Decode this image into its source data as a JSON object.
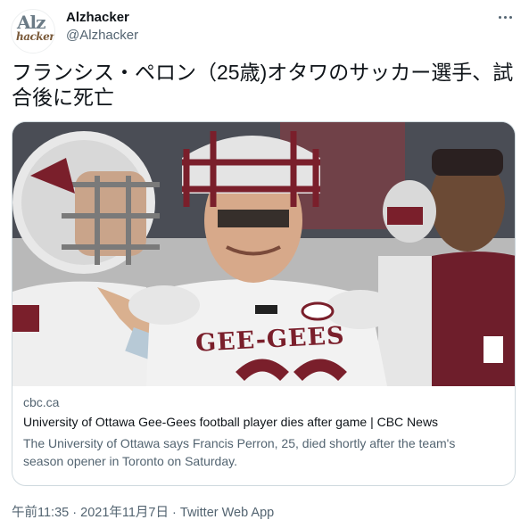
{
  "account": {
    "display_name": "Alzhacker",
    "handle": "@Alzhacker",
    "avatar_logo_top": "Alz",
    "avatar_logo_bottom": "hacker"
  },
  "tweet": {
    "text": "フランシス・ペロン（25歳)オタワのサッカー選手、試合後に死亡"
  },
  "link_card": {
    "image_alt": "Football players in Gee-Gees uniforms",
    "jersey_text": "GEE-GEES",
    "domain": "cbc.ca",
    "title": "University of Ottawa Gee-Gees football player dies after game | CBC News",
    "description": "The University of Ottawa says Francis Perron, 25, died shortly after the team's season opener in Toronto on Saturday."
  },
  "footer": {
    "time": "午前11:35",
    "separator": "·",
    "date": "2021年11月7日",
    "source": "Twitter Web App"
  },
  "icons": {
    "more": "more-horizontal-icon"
  },
  "colors": {
    "text_primary": "#0f1419",
    "text_secondary": "#536471",
    "border": "#cfd9de",
    "team_maroon": "#7a1f2b"
  }
}
